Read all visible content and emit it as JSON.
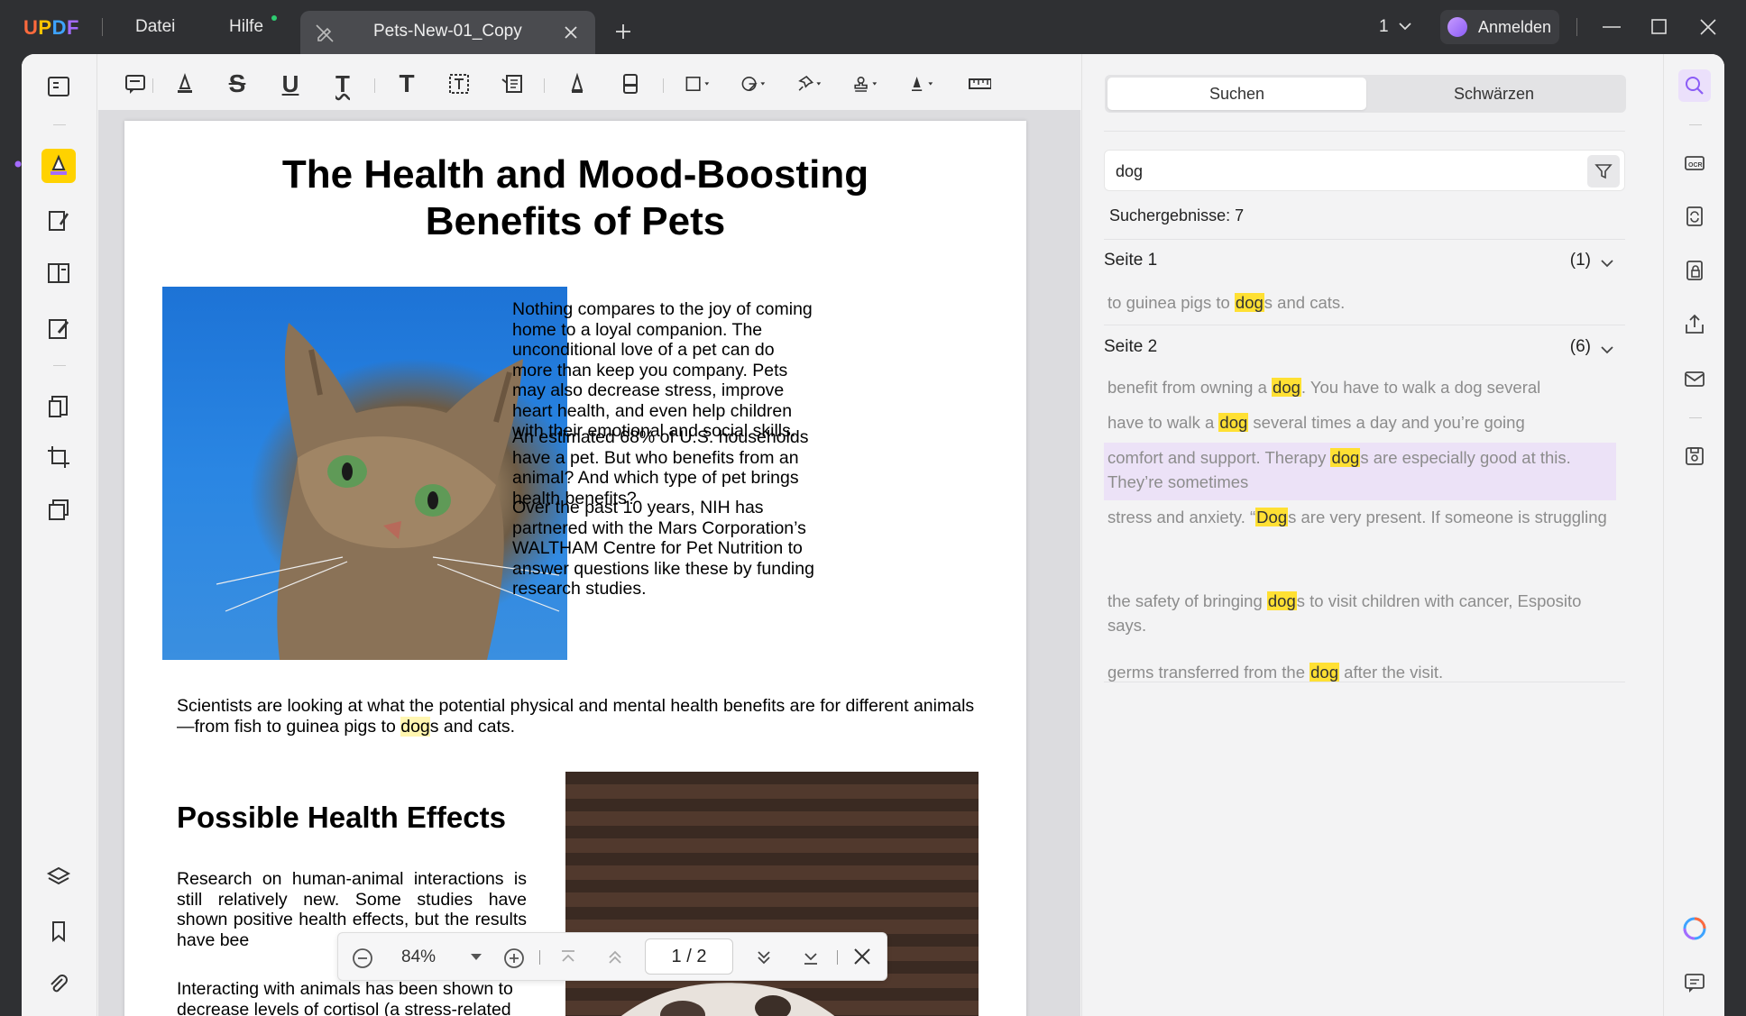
{
  "titlebar": {
    "logo": "UPDF",
    "menu_file": "Datei",
    "menu_help": "Hilfe",
    "tab_title": "Pets-New-01_Copy",
    "page_indicator": "1",
    "signin_label": "Anmelden"
  },
  "document": {
    "title": "The Health and Mood-Boosting Benefits of Pets",
    "para1": "Nothing compares to the joy of coming home to a loyal companion. The unconditional love of a pet can do more than keep you company. Pets may also decrease stress, improve heart health, and even help children with their emotional and social skills.",
    "para2": "An estimated 68% of U.S. households have a pet. But who benefits from an animal? And which type of pet brings health benefits?",
    "para3": "Over the past 10 years, NIH has partnered with the Mars Corporation’s WALTHAM Centre for Pet Nutrition to answer questions like these by funding research studies.",
    "para4_pre": "Scientists are looking at what the potential physical and mental health benefits are for different animals—from fish to guinea pigs to ",
    "para4_hit": "dog",
    "para4_post": "s and cats.",
    "heading2": "Possible Health Effects",
    "para5": "Research on human-animal interactions is still relatively new. Some studies have shown positive health effects, but the results have bee",
    "para6": "Interacting with animals has been shown to decrease levels of cortisol (a stress-related"
  },
  "zoombar": {
    "zoom": "84%",
    "current_page": "1",
    "page_sep": "/",
    "total_pages": "2"
  },
  "search_panel": {
    "tab_search": "Suchen",
    "tab_redact": "Schwärzen",
    "query": "dog",
    "result_count": "Suchergebnisse: 7",
    "groups": [
      {
        "label": "Seite 1",
        "count": "(1)"
      },
      {
        "label": "Seite 2",
        "count": "(6)"
      }
    ],
    "results": [
      {
        "pre": "to guinea pigs to ",
        "hit": "dog",
        "post": "s and cats."
      },
      {
        "pre": "benefit from owning a ",
        "hit": "dog",
        "post": ". You have to walk a dog several"
      },
      {
        "pre": "have to walk a ",
        "hit": "dog",
        "post": " several times a day and you’re going"
      },
      {
        "pre": "comfort and support. Therapy ",
        "hit": "dog",
        "post": "s are especially good at this. They’re sometimes"
      },
      {
        "pre": "stress and anxiety. “",
        "hit": "Dog",
        "post": "s are very present. If someone is struggling"
      },
      {
        "pre": "the safety of bringing ",
        "hit": "dog",
        "post": "s to visit children with cancer, Esposito says."
      },
      {
        "pre": "germs transferred from the ",
        "hit": "dog",
        "post": " after the visit."
      }
    ]
  },
  "colors": {
    "accent": "#a46bff",
    "highlight_hit": "#ffe033",
    "selected_result": "#ece2f7",
    "active_tool": "#ffd200"
  }
}
